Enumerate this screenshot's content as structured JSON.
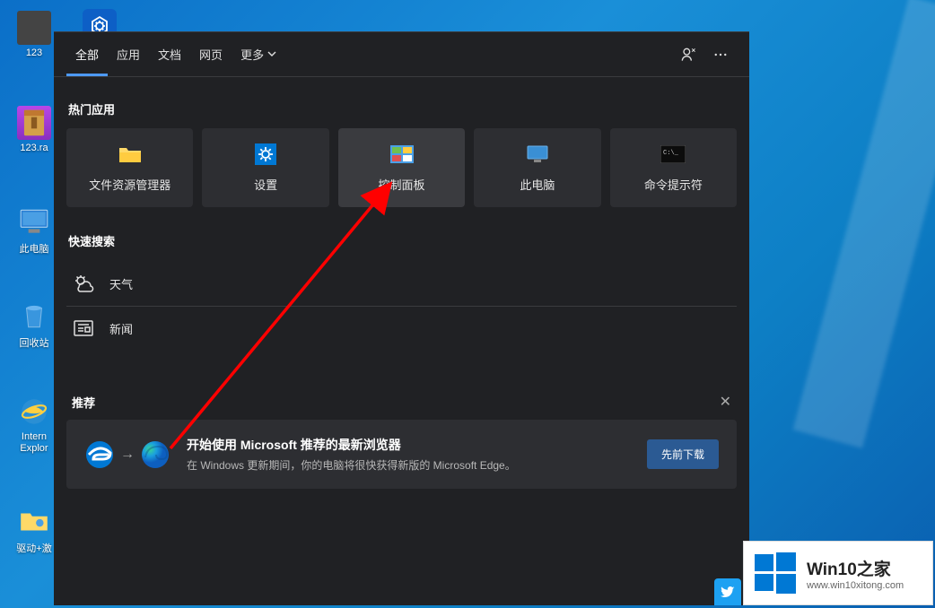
{
  "desktop": {
    "icons": [
      {
        "label": "123",
        "type": "img"
      },
      {
        "label": "123.ra",
        "type": "rar"
      },
      {
        "label": "此电脑",
        "type": "pc"
      },
      {
        "label": "回收站",
        "type": "recycle"
      },
      {
        "label": "Internet Explorer",
        "type": "ie"
      },
      {
        "label": "驱动+激",
        "type": "driver"
      }
    ]
  },
  "panel": {
    "tabs": [
      "全部",
      "应用",
      "文档",
      "网页",
      "更多"
    ],
    "sections": {
      "top_apps_title": "热门应用",
      "quick_search_title": "快速搜索",
      "recommend_title": "推荐"
    },
    "tiles": [
      {
        "label": "文件资源管理器"
      },
      {
        "label": "设置"
      },
      {
        "label": "控制面板"
      },
      {
        "label": "此电脑"
      },
      {
        "label": "命令提示符"
      }
    ],
    "quick": [
      {
        "label": "天气"
      },
      {
        "label": "新闻"
      }
    ],
    "recommend": {
      "title": "开始使用 Microsoft 推荐的最新浏览器",
      "subtitle": "在 Windows 更新期间，你的电脑将很快获得新版的 Microsoft Edge。",
      "button": "先前下载"
    }
  },
  "watermark": {
    "title": "Win10之家",
    "url": "www.win10xitong.com"
  }
}
